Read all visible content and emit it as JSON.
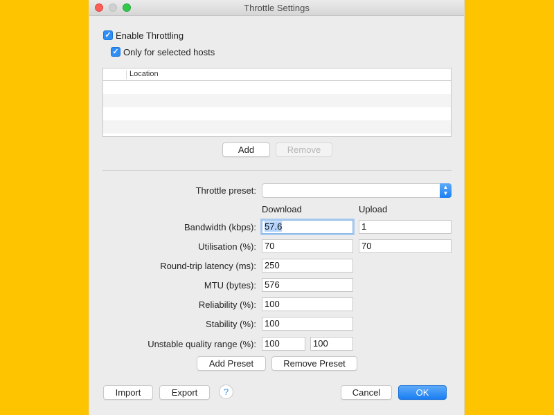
{
  "window": {
    "title": "Throttle Settings"
  },
  "options": {
    "enable_throttling": {
      "label": "Enable Throttling",
      "checked": true
    },
    "only_selected_hosts": {
      "label": "Only for selected hosts",
      "checked": true
    }
  },
  "hosts_table": {
    "columns": [
      "",
      "Location"
    ],
    "rows": []
  },
  "hosts_buttons": {
    "add": "Add",
    "remove": "Remove"
  },
  "preset": {
    "label": "Throttle preset:",
    "value": ""
  },
  "columns": {
    "download": "Download",
    "upload": "Upload"
  },
  "fields": {
    "bandwidth": {
      "label": "Bandwidth (kbps):",
      "download": "57.6",
      "upload": "1"
    },
    "utilisation": {
      "label": "Utilisation (%):",
      "download": "70",
      "upload": "70"
    },
    "latency": {
      "label": "Round-trip latency (ms):",
      "value": "250"
    },
    "mtu": {
      "label": "MTU (bytes):",
      "value": "576"
    },
    "reliability": {
      "label": "Reliability (%):",
      "value": "100"
    },
    "stability": {
      "label": "Stability (%):",
      "value": "100"
    },
    "unstable_range": {
      "label": "Unstable quality range (%):",
      "min": "100",
      "max": "100"
    }
  },
  "preset_buttons": {
    "add": "Add Preset",
    "remove": "Remove Preset"
  },
  "footer": {
    "import": "Import",
    "export": "Export",
    "help": "?",
    "cancel": "Cancel",
    "ok": "OK"
  },
  "colors": {
    "background": "#fec400",
    "accent": "#1a7ff3",
    "window": "#ececec"
  }
}
